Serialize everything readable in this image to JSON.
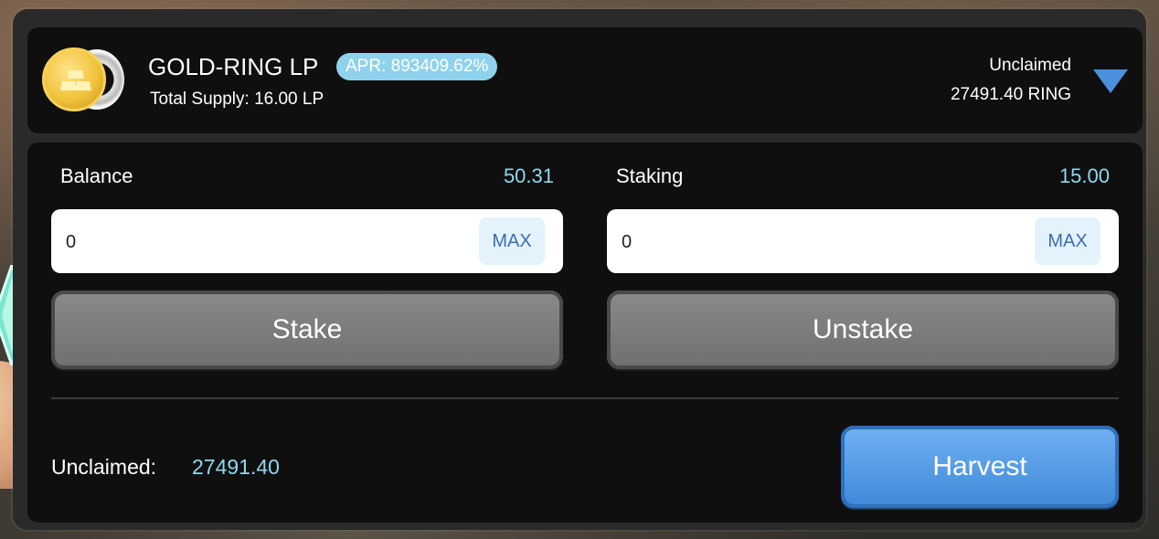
{
  "farm": {
    "pair_name": "GOLD-RING LP",
    "apr": "APR: 893409.62%",
    "total_supply": "Total Supply: 16.00 LP",
    "unclaimed_label": "Unclaimed",
    "unclaimed_value": "27491.40 RING",
    "caret_icon": "triangle-down-icon"
  },
  "stake_panel": {
    "balance_label": "Balance",
    "balance_value": "50.31",
    "stake_input_value": "0",
    "max_label": "MAX",
    "stake_button": "Stake"
  },
  "unstake_panel": {
    "staking_label": "Staking",
    "staking_value": "15.00",
    "unstake_input_value": "0",
    "max_label": "MAX",
    "unstake_button": "Unstake"
  },
  "footer": {
    "unclaimed_label": "Unclaimed:",
    "unclaimed_value": "27491.40",
    "harvest_button": "Harvest"
  },
  "colors": {
    "accent_blue": "#4a90dc",
    "value_cyan": "#8fd8ee",
    "apr_badge": "#8fd2ec",
    "gold": "#f1c33c"
  }
}
